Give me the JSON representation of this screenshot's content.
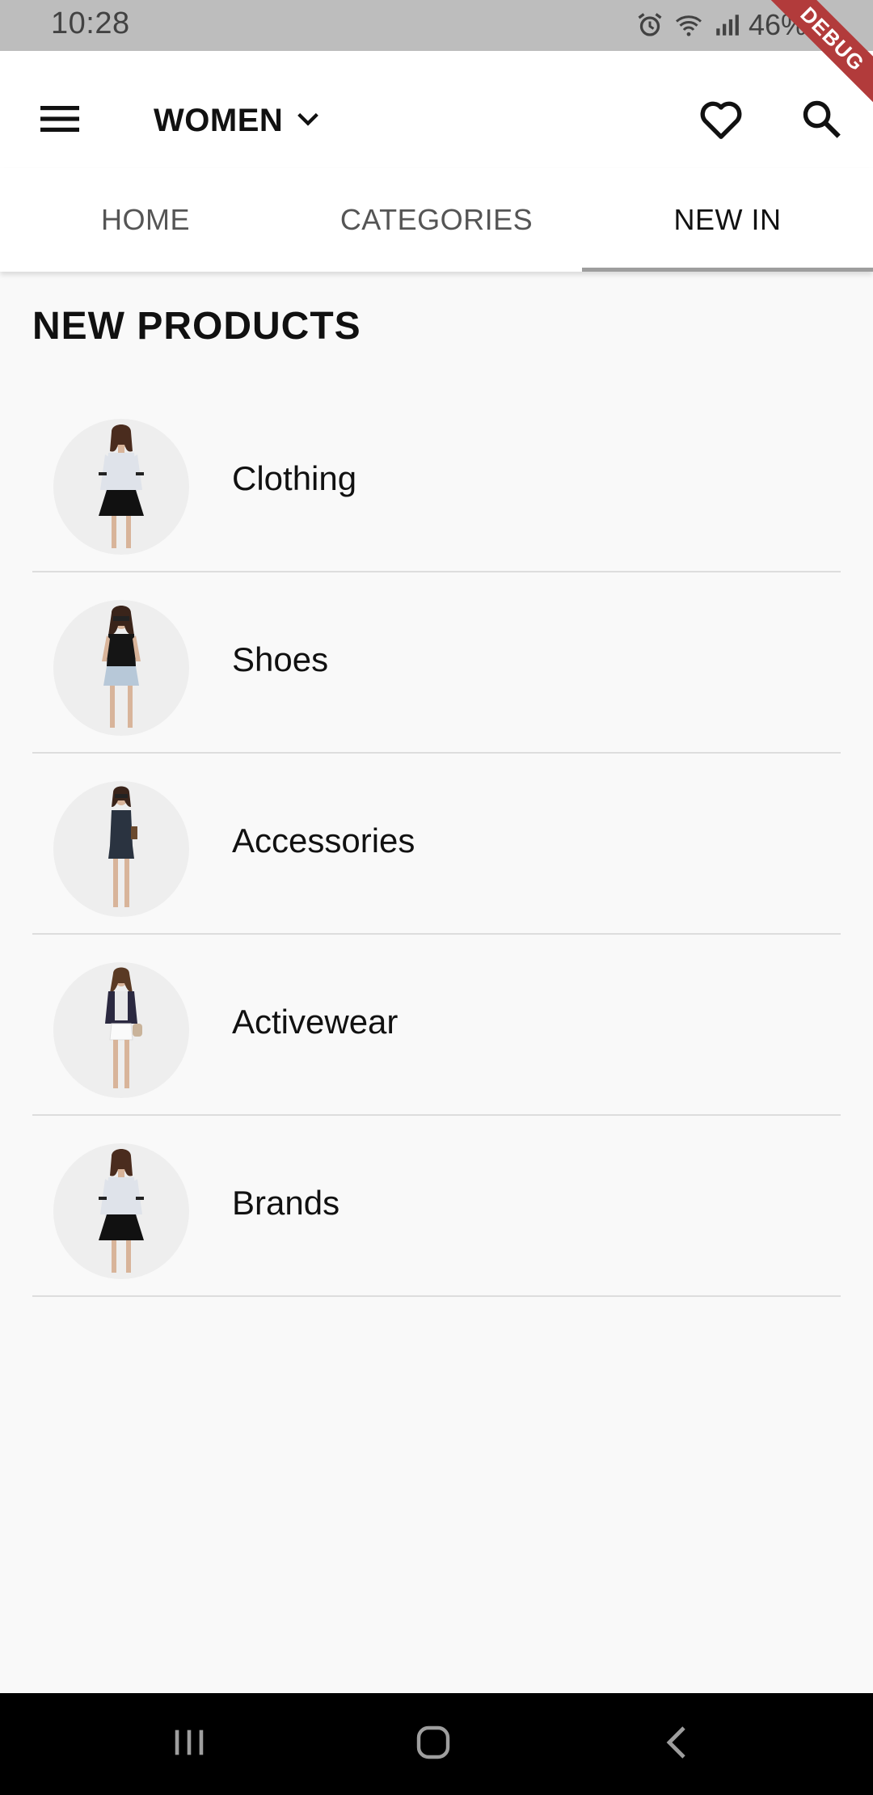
{
  "status_bar": {
    "time": "10:28",
    "battery_percent": "46%",
    "icons": [
      "alarm-icon",
      "wifi-icon",
      "signal-icon",
      "battery-icon"
    ]
  },
  "debug_banner": "DEBUG",
  "app_bar": {
    "menu_icon": "menu-icon",
    "gender": "WOMEN",
    "dropdown_icon": "chevron-down-icon",
    "favorites_icon": "heart-icon",
    "search_icon": "search-icon"
  },
  "tabs": [
    {
      "label": "HOME",
      "active": false
    },
    {
      "label": "CATEGORIES",
      "active": false
    },
    {
      "label": "NEW IN",
      "active": true
    }
  ],
  "section_title": "NEW PRODUCTS",
  "products": [
    {
      "label": "Clothing"
    },
    {
      "label": "Shoes"
    },
    {
      "label": "Accessories"
    },
    {
      "label": "Activewear"
    },
    {
      "label": "Brands"
    }
  ],
  "nav_bar": {
    "icons": [
      "recent-apps-icon",
      "home-icon",
      "back-icon"
    ]
  },
  "colors": {
    "status_bar_bg": "#bdbdbd",
    "app_bar_bg": "#ffffff",
    "content_bg": "#f9f9f9",
    "active_tab_indicator": "#9e9e9e",
    "debug_ribbon": "#b23b3b",
    "nav_bar_bg": "#000000"
  }
}
